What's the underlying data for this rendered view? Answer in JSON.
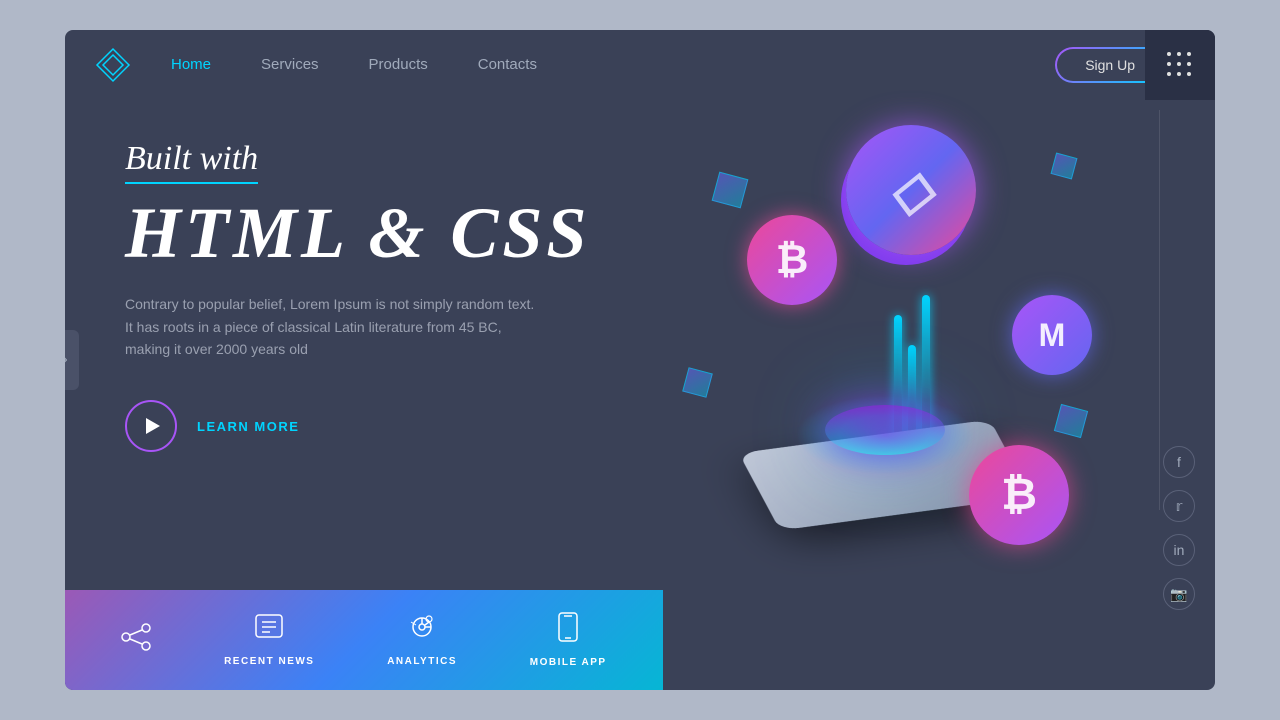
{
  "navbar": {
    "logo_symbol": "◇",
    "links": [
      {
        "label": "Home",
        "active": true
      },
      {
        "label": "Services",
        "active": false
      },
      {
        "label": "Products",
        "active": false
      },
      {
        "label": "Contacts",
        "active": false
      }
    ],
    "signup_label": "Sign Up"
  },
  "hero": {
    "built_with": "Built with",
    "title": "HTML & CSS",
    "description": "Contrary to popular belief, Lorem Ipsum is not simply random text. It has roots in a piece of classical Latin literature from 45 BC, making it over 2000 years old",
    "cta_label": "LEARN MORE"
  },
  "bottom_bar": {
    "items": [
      {
        "label": "RECENT NEWS"
      },
      {
        "label": "ANALYTICS"
      },
      {
        "label": "MOBILE APP"
      }
    ]
  },
  "social": {
    "icons": [
      "f",
      "t",
      "in",
      "ig"
    ]
  },
  "coins": {
    "eth_symbol": "◇",
    "btc_symbol": "₿",
    "monero_symbol": "M",
    "btc_bottom_symbol": "₿"
  },
  "colors": {
    "background": "#3a4157",
    "accent_cyan": "#00d4ff",
    "accent_purple": "#a855f7",
    "nav_active": "#00d4ff",
    "bottom_gradient_start": "#9b59b6",
    "bottom_gradient_end": "#06b6d4"
  }
}
